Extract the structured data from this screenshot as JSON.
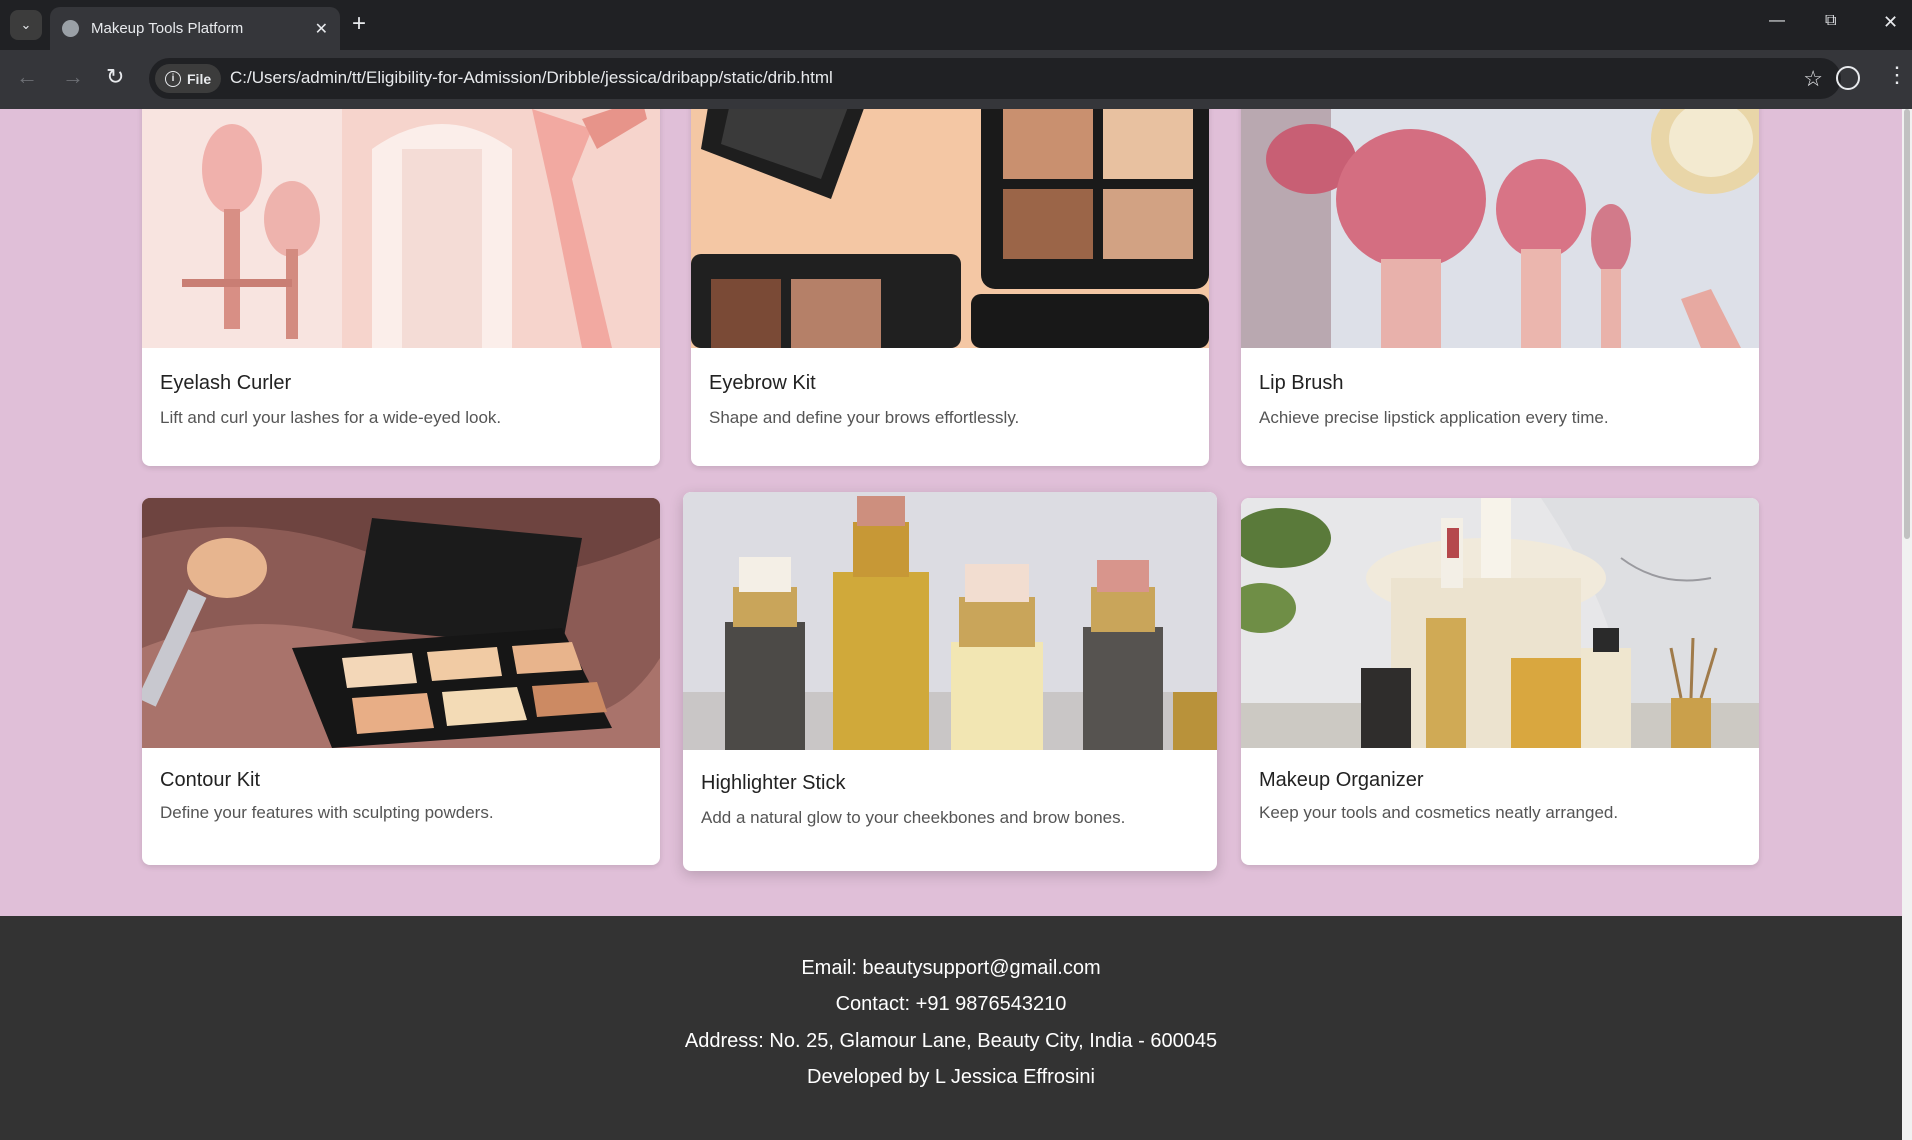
{
  "browser": {
    "tab_title": "Makeup Tools Platform",
    "file_chip": "File",
    "url": "C:/Users/admin/tt/Eligibility-for-Admission/Dribble/jessica/dribapp/static/drib.html"
  },
  "products": [
    {
      "title": "Eyelash Curler",
      "description": "Lift and curl your lashes for a wide-eyed look."
    },
    {
      "title": "Eyebrow Kit",
      "description": "Shape and define your brows effortlessly."
    },
    {
      "title": "Lip Brush",
      "description": "Achieve precise lipstick application every time."
    },
    {
      "title": "Contour Kit",
      "description": "Define your features with sculpting powders."
    },
    {
      "title": "Highlighter Stick",
      "description": "Add a natural glow to your cheekbones and brow bones."
    },
    {
      "title": "Makeup Organizer",
      "description": "Keep your tools and cosmetics neatly arranged."
    }
  ],
  "footer": {
    "email": "Email: beautysupport@gmail.com",
    "contact": "Contact: +91 9876543210",
    "address": "Address: No. 25, Glamour Lane, Beauty City, India - 600045",
    "developer": "Developed by L Jessica Effrosini"
  },
  "colors": {
    "page_background": "#e0bfd8",
    "footer_background": "#333333",
    "browser_frame": "#202124"
  }
}
